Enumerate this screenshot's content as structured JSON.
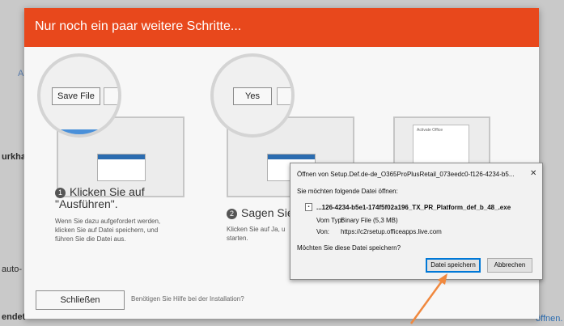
{
  "background": {
    "frag_arkhan": "urkhan",
    "frag_auto": "auto-",
    "frag_endet": "endet",
    "frag_a": "A",
    "link_offnen": "öffnen."
  },
  "dialog": {
    "title": "Nur noch ein paar weitere Schritte...",
    "steps": [
      {
        "number": "1",
        "title": "Klicken Sie auf \"Ausführen\".",
        "desc_lines": [
          "Wenn Sie dazu aufgefordert werden,",
          "klicken Sie auf Datei speichern, und",
          "führen Sie die Datei aus."
        ],
        "magnifier_button": "Save File"
      },
      {
        "number": "2",
        "title": "Sagen Sie",
        "desc_lines": [
          "Klicken Sie auf Ja, u",
          "starten."
        ],
        "magnifier_button": "Yes"
      }
    ],
    "office_card_title": "Activate Office",
    "close_button": "Schließen",
    "help_text": "Benötigen Sie Hilfe bei der Installation?"
  },
  "download_dialog": {
    "title": "Öffnen von Setup.Def.de-de_O365ProPlusRetail_073eedc0-f126-4234-b5...",
    "close_glyph": "✕",
    "question": "Sie möchten folgende Datei öffnen:",
    "file_name": "...126-4234-b5e1-174f5f02a196_TX_PR_Platform_def_b_48_.exe",
    "type_label": "Vom Typ:",
    "type_value": "Binary File (5,3 MB)",
    "from_label": "Von:",
    "from_value": "https://c2rsetup.officeapps.live.com",
    "save_question": "Möchten Sie diese Datei speichern?",
    "save_button": "Datei speichern",
    "cancel_button": "Abbrechen"
  },
  "colors": {
    "header": "#e8481c",
    "arrow": "#f0883e",
    "accent_blue": "#0078d7"
  }
}
